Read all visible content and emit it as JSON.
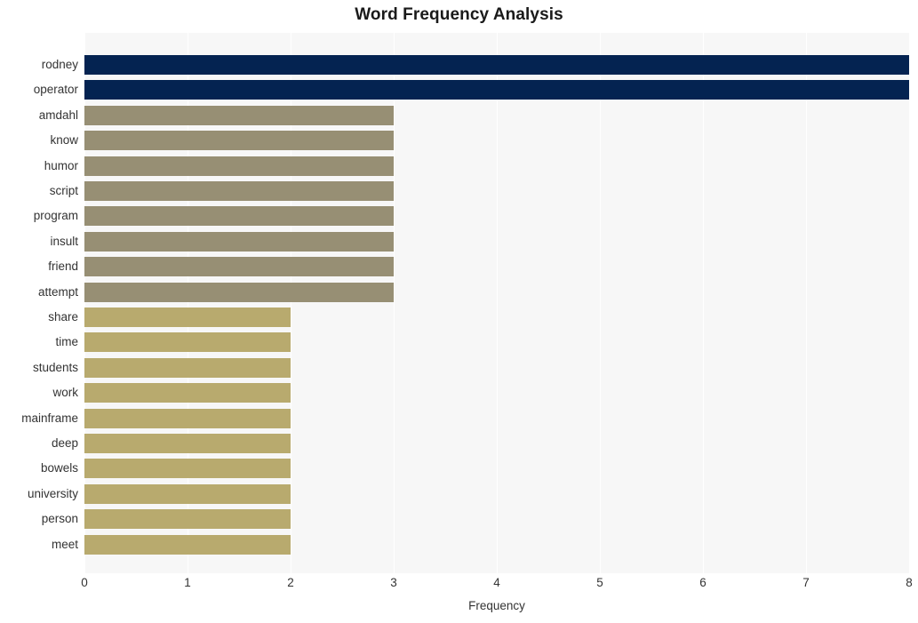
{
  "chart_data": {
    "type": "bar",
    "orientation": "horizontal",
    "title": "Word Frequency Analysis",
    "xlabel": "Frequency",
    "ylabel": "",
    "xlim": [
      0,
      8
    ],
    "xticks": [
      0,
      1,
      2,
      3,
      4,
      5,
      6,
      7,
      8
    ],
    "xtick_labels": [
      "0",
      "1",
      "2",
      "3",
      "4",
      "5",
      "6",
      "7",
      "8"
    ],
    "grid": true,
    "grid_axis": "x",
    "legend": null,
    "categories": [
      "rodney",
      "operator",
      "amdahl",
      "know",
      "humor",
      "script",
      "program",
      "insult",
      "friend",
      "attempt",
      "share",
      "time",
      "students",
      "work",
      "mainframe",
      "deep",
      "bowels",
      "university",
      "person",
      "meet"
    ],
    "values": [
      8,
      8,
      3,
      3,
      3,
      3,
      3,
      3,
      3,
      3,
      2,
      2,
      2,
      2,
      2,
      2,
      2,
      2,
      2,
      2
    ],
    "bar_colors": [
      "#042351",
      "#042351",
      "#978f74",
      "#978f74",
      "#978f74",
      "#978f74",
      "#978f74",
      "#978f74",
      "#978f74",
      "#978f74",
      "#b8aa6e",
      "#b8aa6e",
      "#b8aa6e",
      "#b8aa6e",
      "#b8aa6e",
      "#b8aa6e",
      "#b8aa6e",
      "#b8aa6e",
      "#b8aa6e",
      "#b8aa6e"
    ]
  },
  "style": {
    "plot_background": "#f7f7f7",
    "figure_background": "#ffffff",
    "gridline_color": "#ffffff",
    "text_color": "#333333",
    "title_color": "#1a1a1a"
  }
}
